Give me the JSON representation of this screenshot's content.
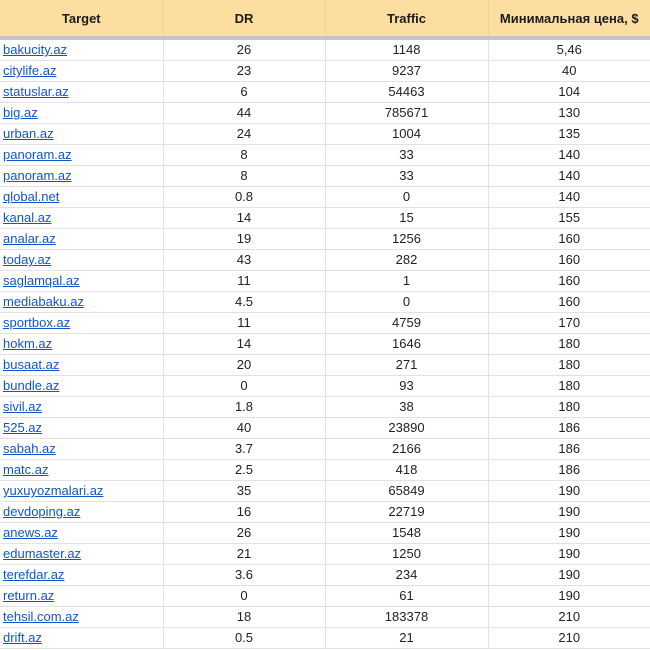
{
  "table": {
    "headers": [
      "Target",
      "DR",
      "Traffic",
      "Минимальная цена, $"
    ],
    "rows": [
      {
        "target": "bakucity.az",
        "dr": "26",
        "traffic": "1148",
        "price": "5,46"
      },
      {
        "target": "citylife.az",
        "dr": "23",
        "traffic": "9237",
        "price": "40"
      },
      {
        "target": "statuslar.az",
        "dr": "6",
        "traffic": "54463",
        "price": "104"
      },
      {
        "target": "big.az",
        "dr": "44",
        "traffic": "785671",
        "price": "130"
      },
      {
        "target": "urban.az",
        "dr": "24",
        "traffic": "1004",
        "price": "135"
      },
      {
        "target": "panoram.az",
        "dr": "8",
        "traffic": "33",
        "price": "140"
      },
      {
        "target": "panoram.az",
        "dr": "8",
        "traffic": "33",
        "price": "140"
      },
      {
        "target": "qlobal.net",
        "dr": "0.8",
        "traffic": "0",
        "price": "140"
      },
      {
        "target": "kanal.az",
        "dr": "14",
        "traffic": "15",
        "price": "155"
      },
      {
        "target": "analar.az",
        "dr": "19",
        "traffic": "1256",
        "price": "160"
      },
      {
        "target": "today.az",
        "dr": "43",
        "traffic": "282",
        "price": "160"
      },
      {
        "target": "saglamqal.az",
        "dr": "11",
        "traffic": "1",
        "price": "160"
      },
      {
        "target": "mediabaku.az",
        "dr": "4.5",
        "traffic": "0",
        "price": "160"
      },
      {
        "target": "sportbox.az",
        "dr": "11",
        "traffic": "4759",
        "price": "170"
      },
      {
        "target": "hokm.az",
        "dr": "14",
        "traffic": "1646",
        "price": "180"
      },
      {
        "target": "busaat.az",
        "dr": "20",
        "traffic": "271",
        "price": "180"
      },
      {
        "target": "bundle.az",
        "dr": "0",
        "traffic": "93",
        "price": "180"
      },
      {
        "target": "sivil.az",
        "dr": "1.8",
        "traffic": "38",
        "price": "180"
      },
      {
        "target": "525.az",
        "dr": "40",
        "traffic": "23890",
        "price": "186"
      },
      {
        "target": "sabah.az",
        "dr": "3.7",
        "traffic": "2166",
        "price": "186"
      },
      {
        "target": "matc.az",
        "dr": "2.5",
        "traffic": "418",
        "price": "186"
      },
      {
        "target": "yuxuyozmalari.az",
        "dr": "35",
        "traffic": "65849",
        "price": "190"
      },
      {
        "target": "devdoping.az",
        "dr": "16",
        "traffic": "22719",
        "price": "190"
      },
      {
        "target": "anews.az",
        "dr": "26",
        "traffic": "1548",
        "price": "190"
      },
      {
        "target": "edumaster.az",
        "dr": "21",
        "traffic": "1250",
        "price": "190"
      },
      {
        "target": "terefdar.az",
        "dr": "3.6",
        "traffic": "234",
        "price": "190"
      },
      {
        "target": "return.az",
        "dr": "0",
        "traffic": "61",
        "price": "190"
      },
      {
        "target": "tehsil.com.az",
        "dr": "18",
        "traffic": "183378",
        "price": "210"
      },
      {
        "target": "drift.az",
        "dr": "0.5",
        "traffic": "21",
        "price": "210"
      }
    ]
  },
  "colors": {
    "header_bg": "#fcdfa0",
    "link": "#1155cc",
    "grid": "#e2e2e2"
  }
}
